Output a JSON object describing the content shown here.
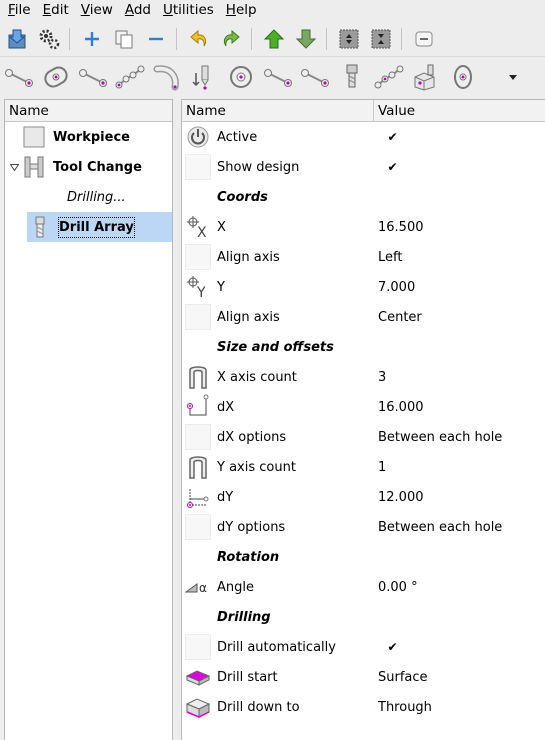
{
  "menubar": {
    "items": [
      {
        "acc": "F",
        "rest": "ile"
      },
      {
        "acc": "E",
        "rest": "dit"
      },
      {
        "acc": "V",
        "rest": "iew"
      },
      {
        "acc": "A",
        "rest": "dd"
      },
      {
        "acc": "U",
        "rest": "tilities"
      },
      {
        "acc": "H",
        "rest": "elp"
      }
    ]
  },
  "toolbar1": {
    "buttons": [
      "open-icon",
      "settings-icon",
      "add-icon",
      "copy-icon",
      "remove-icon",
      "undo-icon",
      "redo-icon",
      "move-up-icon",
      "move-down-icon",
      "group-icon",
      "ungroup-icon",
      "collapse-icon"
    ]
  },
  "toolbar2": {
    "buttons": [
      "slot-icon",
      "oval-pocket-icon",
      "line-icon",
      "polyline-icon",
      "arc-slot-icon",
      "drill-depth-icon",
      "circle-pocket-icon",
      "line-2-icon",
      "line-3-icon",
      "tool-icon",
      "polyline-2-icon",
      "box-drill-icon",
      "oval-icon"
    ]
  },
  "tree": {
    "header": "Name",
    "items": [
      {
        "label": "Workpiece"
      },
      {
        "label": "Tool Change"
      },
      {
        "label": "Drilling..."
      },
      {
        "label": "Drill Array"
      }
    ]
  },
  "properties": {
    "header_name": "Name",
    "header_value": "Value",
    "rows": {
      "active": {
        "name": "Active"
      },
      "show_design": {
        "name": "Show design"
      },
      "coords": {
        "title": "Coords"
      },
      "x": {
        "name": "X",
        "value": "16.500"
      },
      "align_x": {
        "name": "Align axis",
        "value": "Left"
      },
      "y": {
        "name": "Y",
        "value": "7.000"
      },
      "align_y": {
        "name": "Align axis",
        "value": "Center"
      },
      "size": {
        "title": "Size and offsets"
      },
      "x_count": {
        "name": "X axis count",
        "value": "3"
      },
      "dx": {
        "name": "dX",
        "value": "16.000"
      },
      "dx_opt": {
        "name": "dX options",
        "value": "Between each hole"
      },
      "y_count": {
        "name": "Y axis count",
        "value": "1"
      },
      "dy": {
        "name": "dY",
        "value": "12.000"
      },
      "dy_opt": {
        "name": "dY options",
        "value": "Between each hole"
      },
      "rotation": {
        "title": "Rotation"
      },
      "angle": {
        "name": "Angle",
        "value": "0.00 °"
      },
      "drilling": {
        "title": "Drilling"
      },
      "drill_auto": {
        "name": "Drill automatically"
      },
      "drill_start": {
        "name": "Drill start",
        "value": "Surface"
      },
      "drill_down": {
        "name": "Drill down to",
        "value": "Through"
      }
    },
    "check_mark": "✔"
  },
  "colors": {
    "selection": "#bcd7f5",
    "accent_magenta": "#c000c0",
    "arrow_green": "#4caf2a",
    "add_blue": "#2f7fd6"
  }
}
